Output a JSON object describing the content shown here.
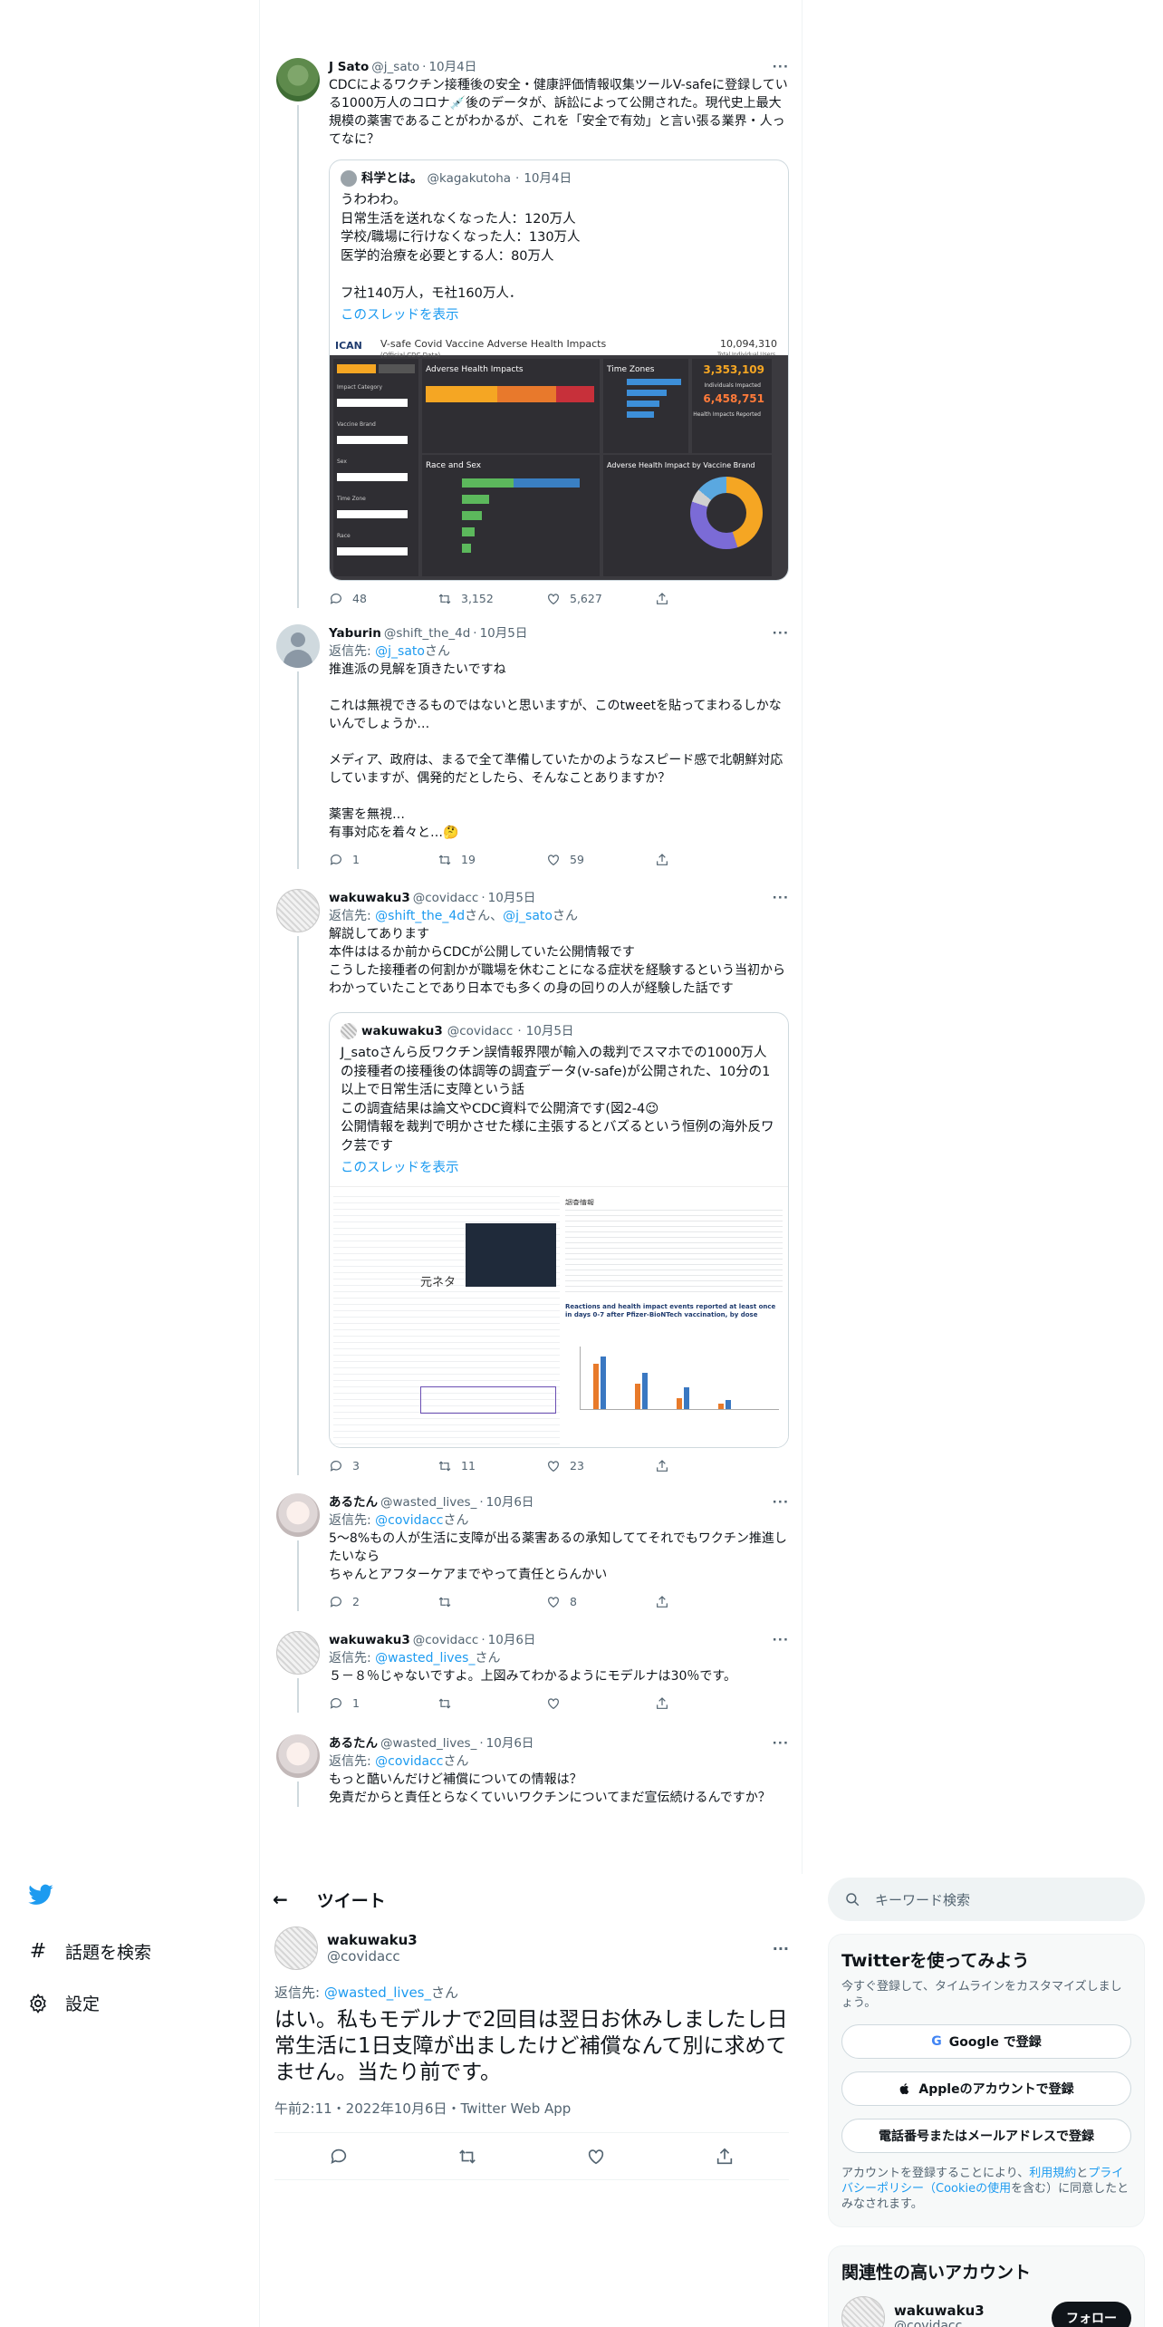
{
  "tweets": [
    {
      "name": "J Sato",
      "handle": "@j_sato",
      "date": "10月4日",
      "text": "CDCによるワクチン接種後の安全・健康評価情報収集ツールV-safeに登録している1000万人のコロナ💉後のデータが、訴訟によって公開された。現代史上最大規模の薬害であることがわかるが、これを「安全で有効」と言い張る業界・人ってなに？",
      "quote": {
        "name": "科学とは。",
        "handle": "@kagakutoha",
        "date": "10月4日",
        "text": "うわわわ。\n日常生活を送れなくなった人：120万人\n学校/職場に行けなくなった人：130万人\n医学的治療を必要とする人：80万人\n\nフ社140万人，モ社160万人．",
        "show_thread": "このスレッドを表示",
        "dashboard": {
          "logo": "ICAN",
          "title": "V-safe Covid Vaccine Adverse Health Impacts",
          "subtitle": "(Official CDC Data)",
          "total_value": "10,094,310",
          "total_label": "Total Individual Users",
          "impacted_value": "3,353,109",
          "impacted_label": "Individuals Impacted",
          "reported_value": "6,458,751",
          "reported_label": "Health Impacts Reported",
          "panels": [
            "Adverse Health Impacts",
            "Time Zones",
            "Race and Sex",
            "Adverse Health Impact by Vaccine Brand"
          ],
          "filters": [
            "Impact Category",
            "Vaccine Brand",
            "Sex",
            "Time Zone",
            "Race"
          ]
        }
      },
      "replies": "48",
      "retweets": "3,152",
      "likes": "5,627"
    },
    {
      "name": "Yaburin",
      "handle": "@shift_the_4d",
      "date": "10月5日",
      "reply_prefix": "返信先: ",
      "reply_to": "@j_sato",
      "reply_suffix": "さん",
      "text": "推進派の見解を頂きたいですね\n\nこれは無視できるものではないと思いますが、このtweetを貼ってまわるしかないんでしょうか…\n\nメディア、政府は、まるで全て準備していたかのようなスピード感で北朝鮮対応していますが、偶発的だとしたら、そんなことありますか？\n\n薬害を無視…\n有事対応を着々と…🤔",
      "replies": "1",
      "retweets": "19",
      "likes": "59"
    },
    {
      "name": "wakuwaku3",
      "handle": "@covidacc",
      "date": "10月5日",
      "reply_prefix": "返信先: ",
      "reply_to": "@shift_the_4d",
      "reply_mid": "さん、",
      "reply_to2": "@j_sato",
      "reply_suffix": "さん",
      "text": "解説してあります\n本件ははるか前からCDCが公開していた公開情報です\nこうした接種者の何割かが職場を休むことになる症状を経験するという当初からわかっていたことであり日本でも多くの身の回りの人が経験した話です",
      "quote": {
        "name": "wakuwaku3",
        "handle": "@covidacc",
        "date": "10月5日",
        "text": "J_satoさんら反ワクチン誤情報界隈が輸入の裁判でスマホでの1000万人の接種者の接種後の体調等の調査データ(v-safe)が公開された、10分の1以上で日常生活に支障という話\nこの調査結果は論文やCDC資料で公開済です(図2-4😉\n公開情報を裁判で明かさせた様に主張するとバズるという恒例の海外反ワク芸です",
        "show_thread": "このスレッドを表示",
        "collage": {
          "left_title": "元ネタ",
          "chart_title": "Reactions and health impact events reported at least once in days 0-7 after Pfizer-BioNTech vaccination, by dose",
          "header": "調査情報"
        }
      },
      "replies": "3",
      "retweets": "11",
      "likes": "23"
    },
    {
      "name": "あるたん",
      "handle": "@wasted_lives_",
      "date": "10月6日",
      "reply_prefix": "返信先: ",
      "reply_to": "@covidacc",
      "reply_suffix": "さん",
      "text": "5～8%もの人が生活に支障が出る薬害あるの承知しててそれでもワクチン推進したいなら\nちゃんとアフターケアまでやって責任とらんかい",
      "replies": "2",
      "retweets": "",
      "likes": "8"
    },
    {
      "name": "wakuwaku3",
      "handle": "@covidacc",
      "date": "10月6日",
      "reply_prefix": "返信先: ",
      "reply_to": "@wasted_lives_",
      "reply_suffix": "さん",
      "text": "５－８％じゃないですよ。上図みてわかるようにモデルナは30％です。",
      "replies": "1",
      "retweets": "",
      "likes": ""
    },
    {
      "name": "あるたん",
      "handle": "@wasted_lives_",
      "date": "10月6日",
      "reply_prefix": "返信先: ",
      "reply_to": "@covidacc",
      "reply_suffix": "さん",
      "text": "もっと酷いんだけど補償についての情報は？\n免責だからと責任とらなくていいワクチンについてまだ宣伝続けるんですか？"
    }
  ],
  "focused": {
    "header_title": "ツイート",
    "name": "wakuwaku3",
    "handle": "@covidacc",
    "reply_prefix": "返信先: ",
    "reply_to": "@wasted_lives_",
    "reply_suffix": "さん",
    "text": "はい。私もモデルナで2回目は翌日お休みしましたし日常生活に1日支障が出ましたけど補償なんて別に求めてません。当たり前です。",
    "meta": "午前2:11・2022年10月6日・Twitter Web App"
  },
  "nav": {
    "items": [
      {
        "label": "話題を検索",
        "icon": "hashtag-icon"
      },
      {
        "label": "設定",
        "icon": "gear-icon"
      }
    ]
  },
  "right": {
    "search_placeholder": "キーワード検索",
    "signup_title": "Twitterを使ってみよう",
    "signup_sub": "今すぐ登録して、タイムラインをカスタマイズしましょう。",
    "google_btn": "Google で登録",
    "apple_btn": "Appleのアカウントで登録",
    "phone_btn": "電話番号またはメールアドレスで登録",
    "legal_1": "アカウントを登録することにより、",
    "legal_terms": "利用規約",
    "legal_and": "と",
    "legal_privacy": "プライバシーポリシー",
    "legal_cookie": "（Cookieの使用",
    "legal_2": "を含む）に同意したとみなされます。",
    "relevant_title": "関連性の高いアカウント",
    "relevant_name": "wakuwaku3",
    "relevant_handle": "@covidacc",
    "follow_label": "フォロー"
  },
  "colors": {
    "accent": "#1d9bf0",
    "text": "#0f1419",
    "muted": "#536471"
  }
}
